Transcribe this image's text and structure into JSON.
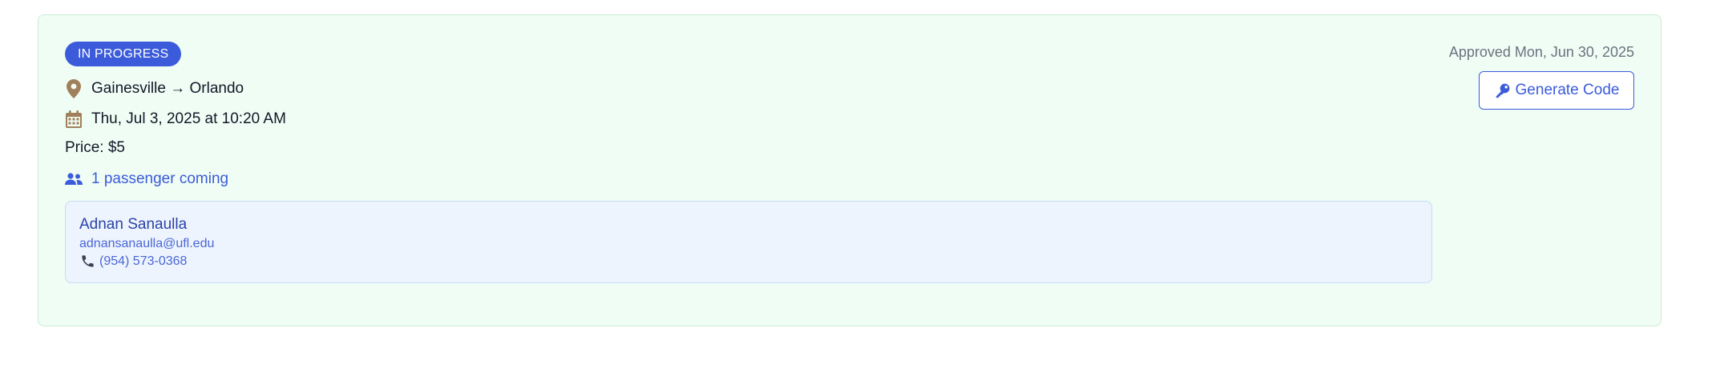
{
  "ride": {
    "status": "IN PROGRESS",
    "route": "Gainesville → Orlando",
    "datetime": "Thu, Jul 3, 2025 at 10:20 AM",
    "price": "Price: $5",
    "passenger_summary": "1 passenger coming",
    "approved": "Approved Mon, Jun 30, 2025",
    "generate_label": "Generate Code"
  },
  "passenger": {
    "name": "Adnan Sanaulla",
    "email": "adnansanaulla@ufl.edu",
    "phone": "(954) 573-0368"
  },
  "icons": {
    "route": "map-pin-icon",
    "date": "calendar-icon",
    "passengers": "users-icon",
    "phone": "phone-icon",
    "generate": "key-icon"
  },
  "colors": {
    "card_bg": "#f0fdf4",
    "accent": "#3b5bdb",
    "icon_brown": "#a0805a",
    "passenger_card_bg": "#eef4fd"
  }
}
